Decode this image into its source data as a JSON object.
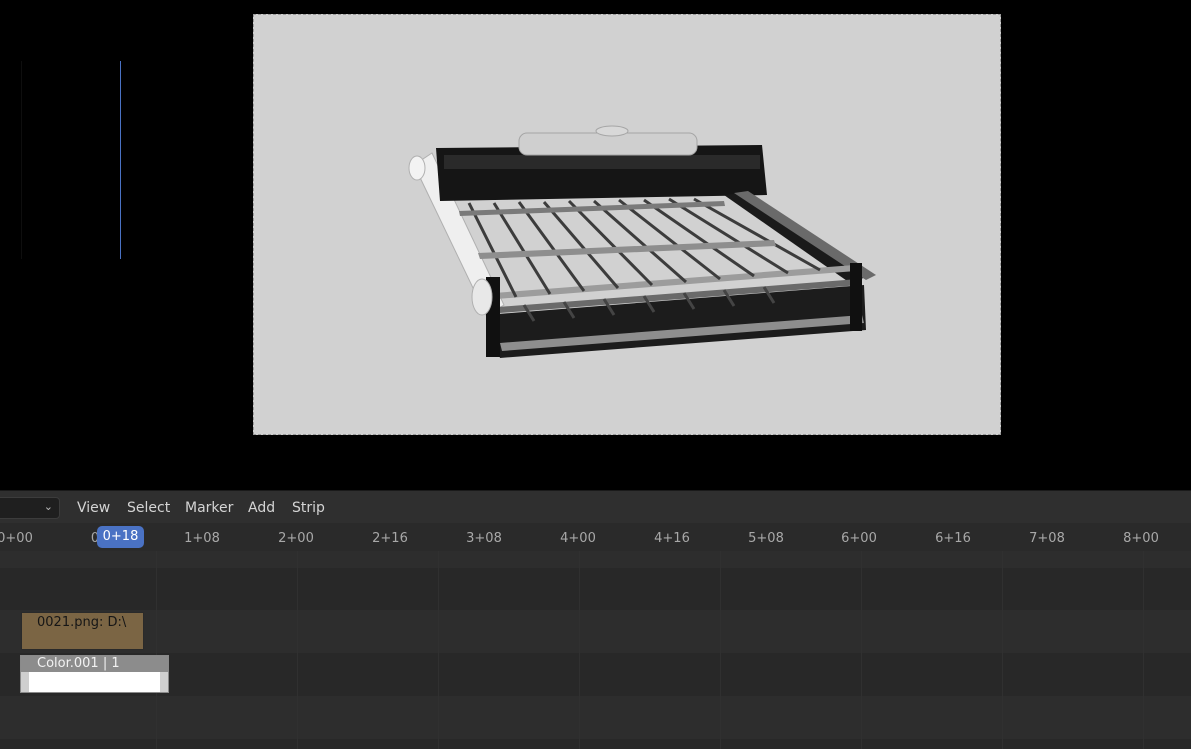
{
  "header": {
    "menus": [
      "View",
      "Select",
      "Marker",
      "Add",
      "Strip"
    ]
  },
  "timeline": {
    "ticks": [
      "0+00",
      "0",
      "1+08",
      "2+00",
      "2+16",
      "3+08",
      "4+00",
      "4+16",
      "5+08",
      "6+00",
      "6+16",
      "7+08",
      "8+00"
    ],
    "current_frame": "0+18"
  },
  "strips": {
    "image_strip": "0021.png: D:\\",
    "color_strip": "Color.001 | 1"
  },
  "colors": {
    "playhead": "#4a72c4",
    "image_strip": "#7b6544",
    "color_strip": "#ffffff"
  }
}
